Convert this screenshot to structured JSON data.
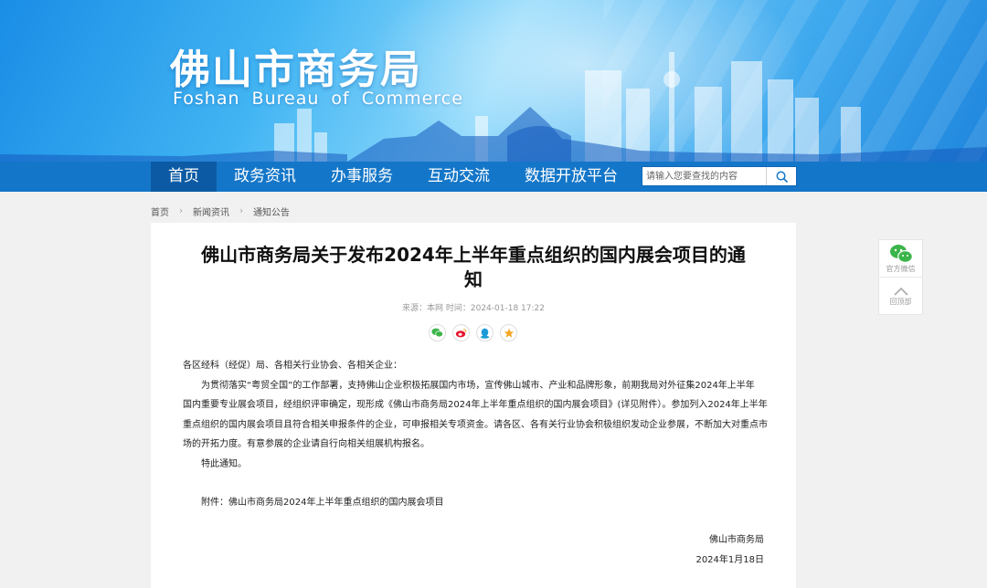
{
  "header": {
    "logo_cn": "佛山市商务局",
    "logo_en": "Foshan Bureau of Commerce"
  },
  "nav": {
    "items": [
      {
        "label": "首页",
        "active": true
      },
      {
        "label": "政务资讯"
      },
      {
        "label": "办事服务"
      },
      {
        "label": "互动交流"
      },
      {
        "label": "数据开放平台"
      }
    ],
    "search_placeholder": "请输入您要查找的内容"
  },
  "breadcrumb": [
    "首页",
    "新闻资讯",
    "通知公告"
  ],
  "article": {
    "title_line1": "佛山市商务局关于发布2024年上半年重点组织的国内展会项目的通",
    "title_line2": "知",
    "meta": "来源：本网 时间：2024-01-18 17:22",
    "share_icons": [
      "wechat-icon",
      "weibo-icon",
      "qq-icon",
      "favorite-icon"
    ],
    "greeting": "各区经科（经促）局、各相关行业协会、各相关企业：",
    "para1": [
      "为贯彻落实“粤贸全国”的工作部署，支持佛山企业积极拓展国内市场，宣传佛山城市、产业和品牌形象，前期我局对外征集2024年上半年",
      "国内重要专业展会项目，经组织评审确定，现形成《佛山市商务局2024年上半年重点组织的国内展会项目》(详见附件）。参加列入2024年上半年",
      "重点组织的国内展会项目且符合相关申报条件的企业，可申报相关专项资金。请各区、各有关行业协会积极组织发动企业参展，不断加大对重点市",
      "场的开拓力度。有意参展的企业请自行向相关组展机构报名。"
    ],
    "closing": "特此通知。",
    "attachment": "附件：佛山市商务局2024年上半年重点组织的国内展会项目",
    "sign_org": "佛山市商务局",
    "sign_date": "2024年1月18日"
  },
  "float_tools": {
    "wechat_label": "官方微信",
    "top_label": "回顶部"
  },
  "colors": {
    "nav_bg": "#1476c8",
    "nav_active": "#0b5aa3",
    "page_bg": "#f1f1f1"
  }
}
